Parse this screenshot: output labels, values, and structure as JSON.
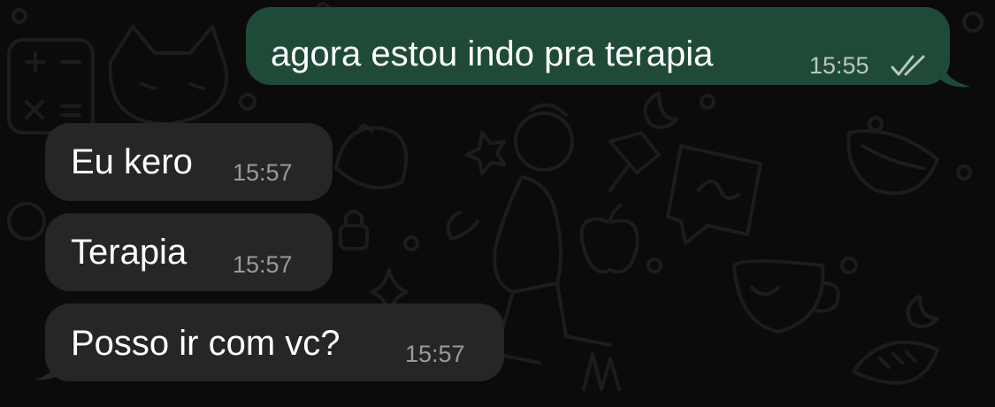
{
  "colors": {
    "background": "#0b0b0b",
    "outgoing_bubble": "#1f4a37",
    "incoming_bubble": "#262626",
    "text": "#ffffff",
    "outgoing_meta": "#b9c8be",
    "incoming_meta": "#9a9a9a",
    "doodle_stroke": "#1c1c1c"
  },
  "messages": [
    {
      "direction": "outgoing",
      "text": "agora estou indo pra terapia",
      "time": "15:55",
      "status_icon": "double-check-icon"
    },
    {
      "direction": "incoming",
      "text": "Eu kero",
      "time": "15:57"
    },
    {
      "direction": "incoming",
      "text": "Terapia",
      "time": "15:57"
    },
    {
      "direction": "incoming",
      "text": "Posso ir com vc?",
      "time": "15:57"
    }
  ],
  "wallpaper": {
    "icons": [
      "cat-icon",
      "calculator-icon",
      "dumpling-icon",
      "pushpin-icon",
      "speech-bubble-icon",
      "apple-icon",
      "teacup-icon",
      "crescent-moon-icon",
      "football-icon",
      "lock-icon",
      "sparkle-icon",
      "person-walking-icon"
    ]
  }
}
